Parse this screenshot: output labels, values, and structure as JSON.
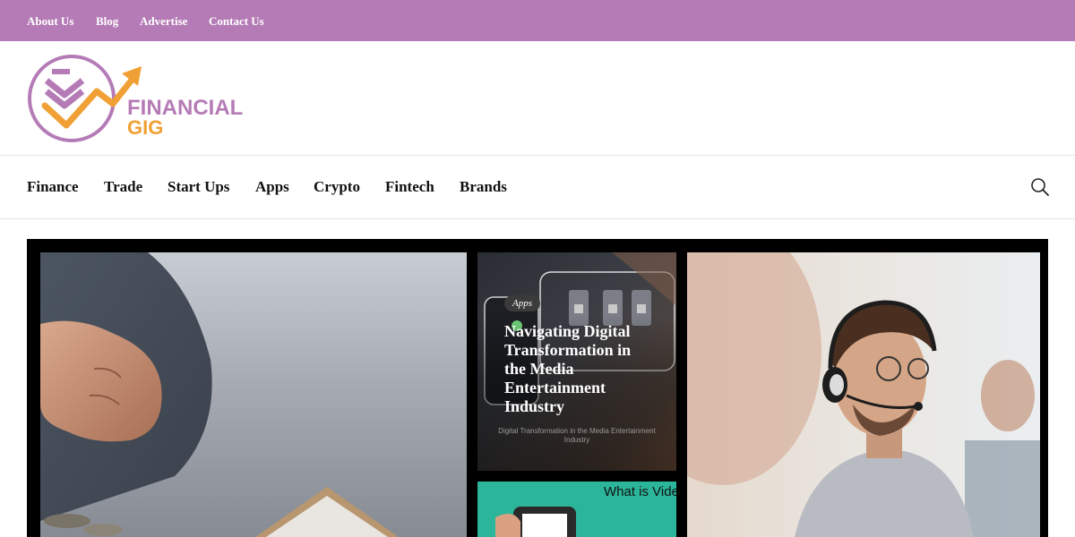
{
  "topbar": {
    "links": [
      "About Us",
      "Blog",
      "Advertise",
      "Contact Us"
    ]
  },
  "logo": {
    "line1": "FINANCIAL",
    "line2": "GIG",
    "colors": {
      "purple": "#b57bb6",
      "orange": "#f0a035"
    }
  },
  "nav": {
    "items": [
      "Finance",
      "Trade",
      "Start Ups",
      "Apps",
      "Crypto",
      "Fintech",
      "Brands"
    ],
    "search_icon": "search-icon"
  },
  "featured": {
    "card2": {
      "category": "Apps",
      "title": "Navigating Digital Transformation in the Media Entertainment Industry",
      "image_caption": "Digital Transformation in the Media Entertainment Industry"
    },
    "card3": {
      "image_text": "What is Video Marketing - Sandwich"
    }
  },
  "colors": {
    "accent": "#b57bb6",
    "nav_text": "#111111",
    "featured_bg": "#000000"
  }
}
